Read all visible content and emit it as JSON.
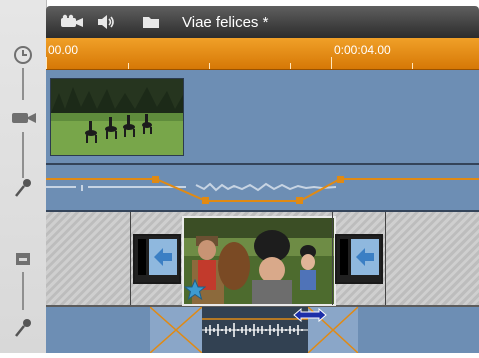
{
  "window": {
    "title": "Viae felices *"
  },
  "toolbar": {
    "icons": [
      "video-camera-icon",
      "speaker-icon",
      "folder-icon"
    ]
  },
  "ruler": {
    "start_timecode": "00.00",
    "mid_timecode": "0:00:04.00"
  },
  "left_column": {
    "icons": [
      "clock-icon",
      "video-track-icon",
      "microphone-icon",
      "storyboard-icon",
      "microphone-icon"
    ]
  },
  "tracks": {
    "video": {
      "clip_icon": "horse-riders-thumbnail"
    },
    "transitions": {
      "left_transition": "slide-left-transition-icon",
      "right_transition": "slide-left-transition-icon",
      "badge": "star-icon"
    },
    "audio_bottom": {
      "handle": "double-arrow-icon"
    }
  },
  "colors": {
    "ruler_accent": "#e08a14",
    "track_blue": "#6d8eb4",
    "envelope": "#e08a14",
    "titlebar": "#3a3a3a"
  }
}
